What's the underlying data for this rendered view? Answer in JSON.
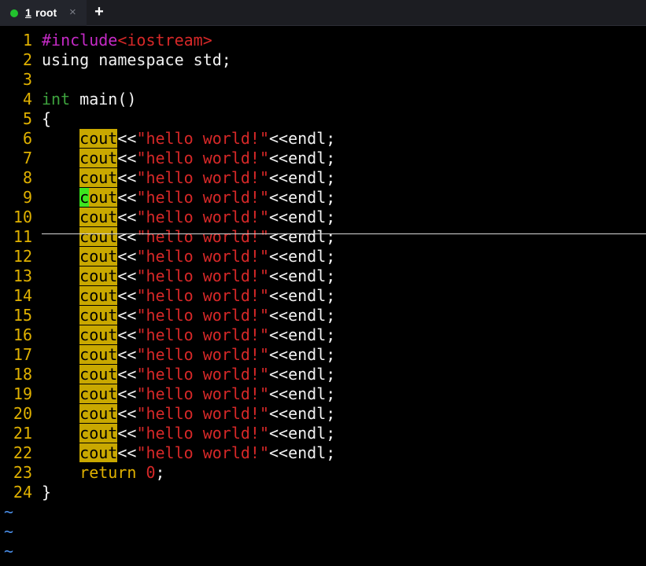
{
  "tabbar": {
    "tab": {
      "number": "1",
      "title": "root",
      "close_glyph": "×",
      "status_color": "#22c32e"
    },
    "new_tab_glyph": "+"
  },
  "editor": {
    "language": "cpp",
    "cursor": {
      "line": 9,
      "column": 5
    },
    "search_highlight": "cout",
    "lines": [
      {
        "n": "1",
        "text": "#include<iostream>"
      },
      {
        "n": "2",
        "text": "using namespace std;"
      },
      {
        "n": "3",
        "text": ""
      },
      {
        "n": "4",
        "text": "int main()"
      },
      {
        "n": "5",
        "text": "{"
      },
      {
        "n": "6",
        "text": "    cout<<\"hello world!\"<<endl;"
      },
      {
        "n": "7",
        "text": "    cout<<\"hello world!\"<<endl;"
      },
      {
        "n": "8",
        "text": "    cout<<\"hello world!\"<<endl;"
      },
      {
        "n": "9",
        "text": "    cout<<\"hello world!\"<<endl;"
      },
      {
        "n": "10",
        "text": "    cout<<\"hello world!\"<<endl;"
      },
      {
        "n": "11",
        "text": "    cout<<\"hello world!\"<<endl;"
      },
      {
        "n": "12",
        "text": "    cout<<\"hello world!\"<<endl;"
      },
      {
        "n": "13",
        "text": "    cout<<\"hello world!\"<<endl;"
      },
      {
        "n": "14",
        "text": "    cout<<\"hello world!\"<<endl;"
      },
      {
        "n": "15",
        "text": "    cout<<\"hello world!\"<<endl;"
      },
      {
        "n": "16",
        "text": "    cout<<\"hello world!\"<<endl;"
      },
      {
        "n": "17",
        "text": "    cout<<\"hello world!\"<<endl;"
      },
      {
        "n": "18",
        "text": "    cout<<\"hello world!\"<<endl;"
      },
      {
        "n": "19",
        "text": "    cout<<\"hello world!\"<<endl;"
      },
      {
        "n": "20",
        "text": "    cout<<\"hello world!\"<<endl;"
      },
      {
        "n": "21",
        "text": "    cout<<\"hello world!\"<<endl;"
      },
      {
        "n": "22",
        "text": "    cout<<\"hello world!\"<<endl;"
      },
      {
        "n": "23",
        "text": "    return 0;"
      },
      {
        "n": "24",
        "text": "}"
      }
    ],
    "tildes": [
      "~",
      "~",
      "~"
    ]
  },
  "colors": {
    "background": "#000000",
    "line_number": "#e0b100",
    "preprocessor": "#c52ac6",
    "type_keyword": "#3da23d",
    "return_keyword": "#e0b100",
    "string": "#d62828",
    "search_highlight": "#c9a800",
    "cursor": "#3de51f",
    "tilde": "#4a8ee8"
  }
}
